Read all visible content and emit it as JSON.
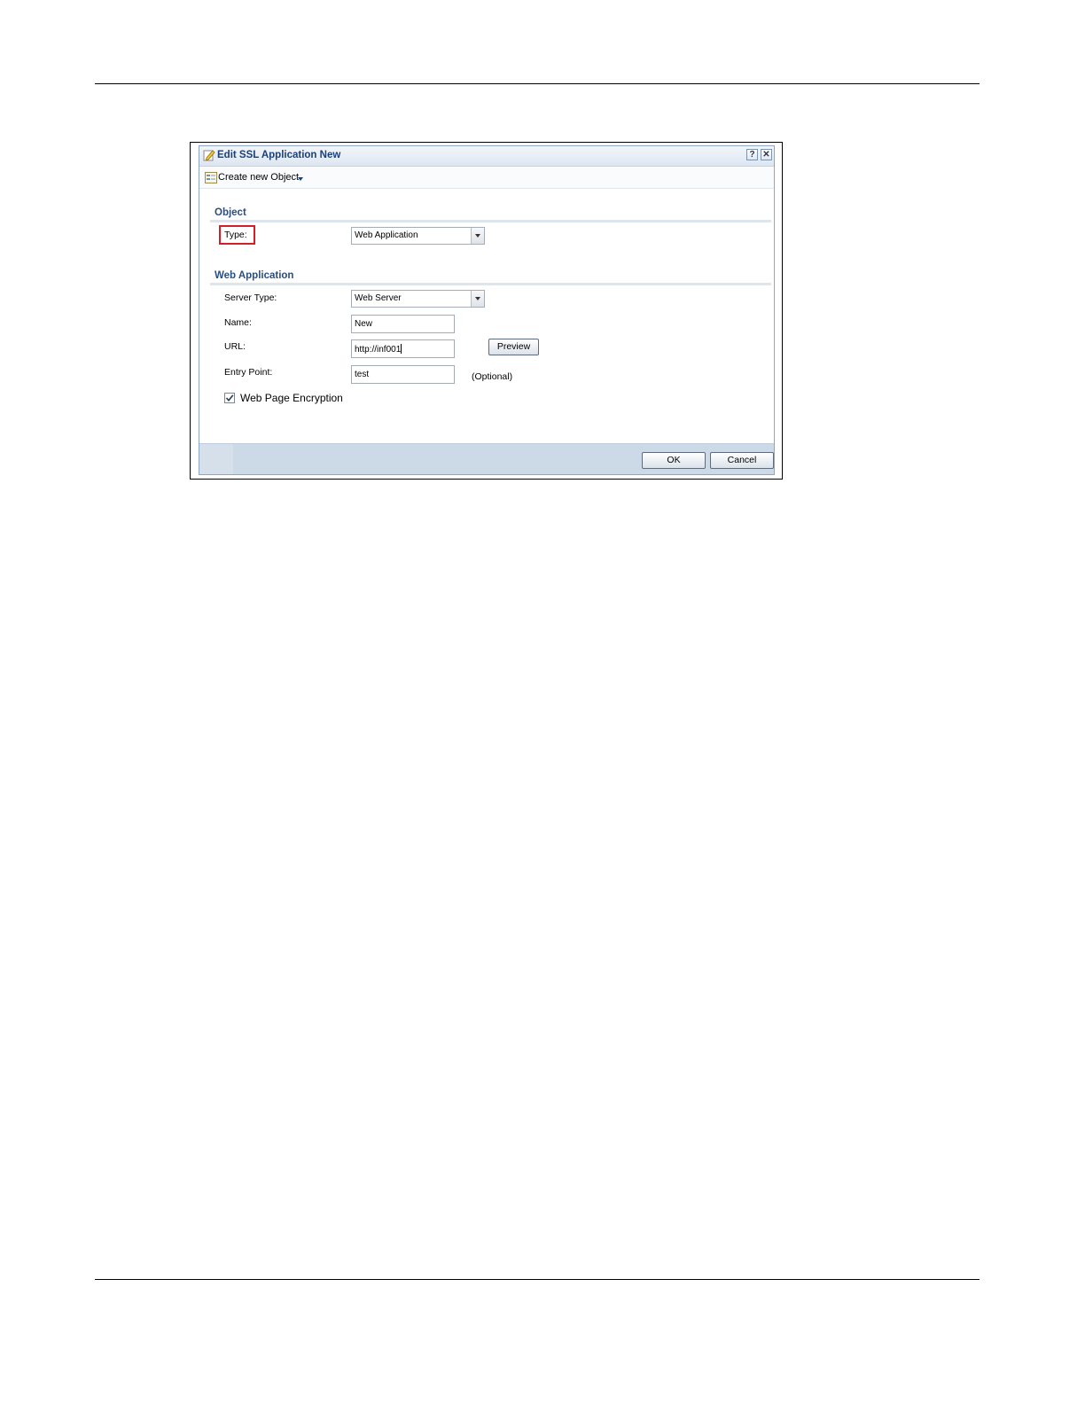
{
  "dialog": {
    "title": "Edit SSL Application New",
    "help_label": "?",
    "close_label": "✕"
  },
  "toolbar": {
    "create_label": "Create new Object"
  },
  "object_section": {
    "title": "Object",
    "type_label": "Type:",
    "type_value": "Web Application"
  },
  "web_app_section": {
    "title": "Web Application",
    "server_type_label": "Server Type:",
    "server_type_value": "Web Server",
    "name_label": "Name:",
    "name_value": "New",
    "url_label": "URL:",
    "url_value": "http://inf001",
    "preview_label": "Preview",
    "entry_point_label": "Entry Point:",
    "entry_point_value": "test",
    "optional_label": "(Optional)",
    "encryption_label": "Web Page Encryption",
    "encryption_checked": true
  },
  "footer": {
    "ok_label": "OK",
    "cancel_label": "Cancel"
  }
}
